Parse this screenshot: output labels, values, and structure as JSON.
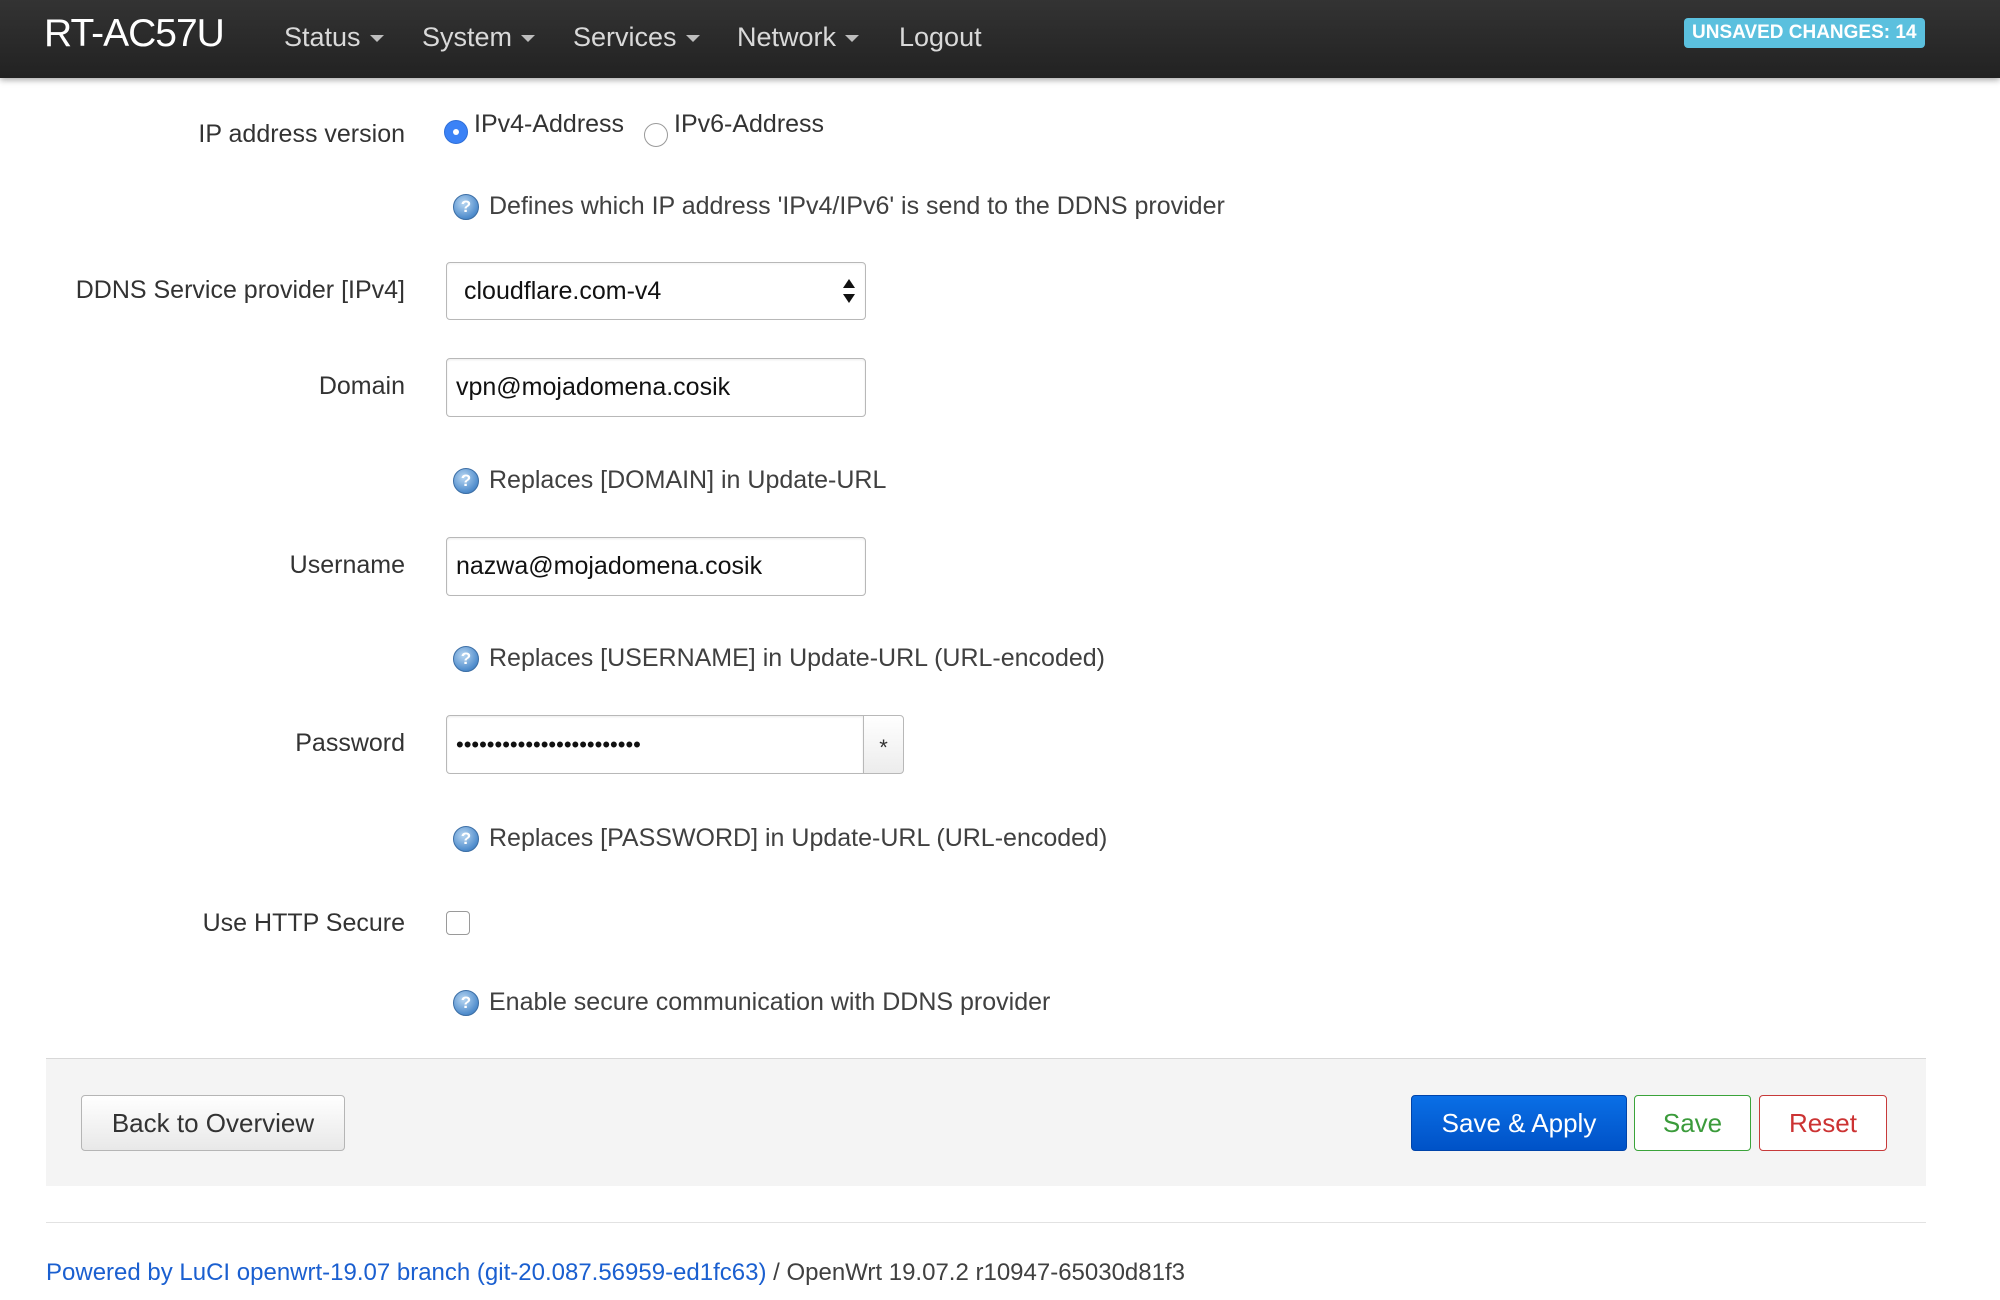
{
  "navbar": {
    "brand": "RT-AC57U",
    "menu": [
      {
        "label": "Status",
        "has_caret": true
      },
      {
        "label": "System",
        "has_caret": true
      },
      {
        "label": "Services",
        "has_caret": true
      },
      {
        "label": "Network",
        "has_caret": true
      },
      {
        "label": "Logout",
        "has_caret": false
      }
    ],
    "unsaved_badge": "UNSAVED CHANGES: 14"
  },
  "form": {
    "ip_version": {
      "label": "IP address version",
      "options": [
        "IPv4-Address",
        "IPv6-Address"
      ],
      "selected": "IPv4-Address",
      "help": "Defines which IP address 'IPv4/IPv6' is send to the DDNS provider"
    },
    "service_provider": {
      "label": "DDNS Service provider [IPv4]",
      "value": "cloudflare.com-v4"
    },
    "domain": {
      "label": "Domain",
      "value": "vpn@mojadomena.cosik",
      "help": "Replaces [DOMAIN] in Update-URL"
    },
    "username": {
      "label": "Username",
      "value": "nazwa@mojadomena.cosik",
      "help": "Replaces [USERNAME] in Update-URL (URL-encoded)"
    },
    "password": {
      "label": "Password",
      "masked_value": "••••••••••••••••••••••••",
      "toggle_glyph": "*",
      "help": "Replaces [PASSWORD] in Update-URL (URL-encoded)"
    },
    "https": {
      "label": "Use HTTP Secure",
      "checked": false,
      "help": "Enable secure communication with DDNS provider"
    }
  },
  "actions": {
    "back": "Back to Overview",
    "save_apply": "Save & Apply",
    "save": "Save",
    "reset": "Reset"
  },
  "footer": {
    "link_text": "Powered by LuCI openwrt-19.07 branch (git-20.087.56959-ed1fc63)",
    "rest_text": " / OpenWrt 19.07.2 r10947-65030d81f3"
  },
  "colors": {
    "navbar_bg": "#222222",
    "badge_bg": "#5bc0de",
    "primary_button": "#0052c7",
    "save_green": "#3b9b3b",
    "reset_red": "#cc3333",
    "link_blue": "#1a5fd0"
  }
}
